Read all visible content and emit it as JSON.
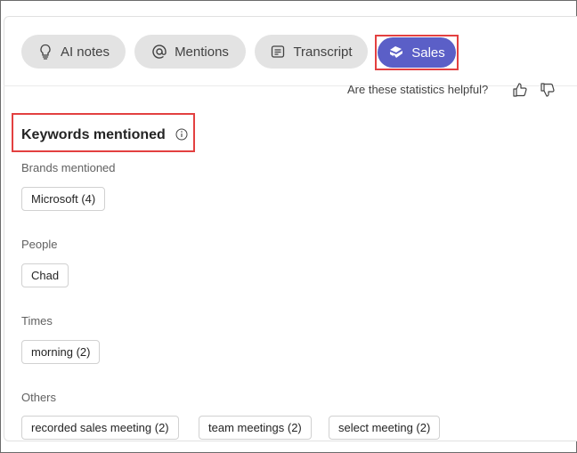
{
  "tabs": [
    {
      "label": "AI notes",
      "icon": "lightbulb-icon"
    },
    {
      "label": "Mentions",
      "icon": "at-sign-icon"
    },
    {
      "label": "Transcript",
      "icon": "transcript-icon"
    },
    {
      "label": "Sales",
      "icon": "sales-icon",
      "active": true
    }
  ],
  "feedback": {
    "question": "Are these statistics helpful?",
    "up_icon": "thumbs-up-icon",
    "down_icon": "thumbs-down-icon"
  },
  "keywords": {
    "title": "Keywords mentioned",
    "info_icon": "info-icon",
    "groups": [
      {
        "label": "Brands mentioned",
        "chips": [
          "Microsoft (4)"
        ]
      },
      {
        "label": "People",
        "chips": [
          "Chad"
        ]
      },
      {
        "label": "Times",
        "chips": [
          "morning (2)"
        ]
      },
      {
        "label": "Others",
        "chips": [
          "recorded sales meeting (2)",
          "team meetings (2)",
          "select meeting (2)"
        ]
      }
    ]
  },
  "colors": {
    "accent": "#5b5fc7",
    "highlight": "#e34040",
    "tab_bg": "#e3e3e3"
  }
}
